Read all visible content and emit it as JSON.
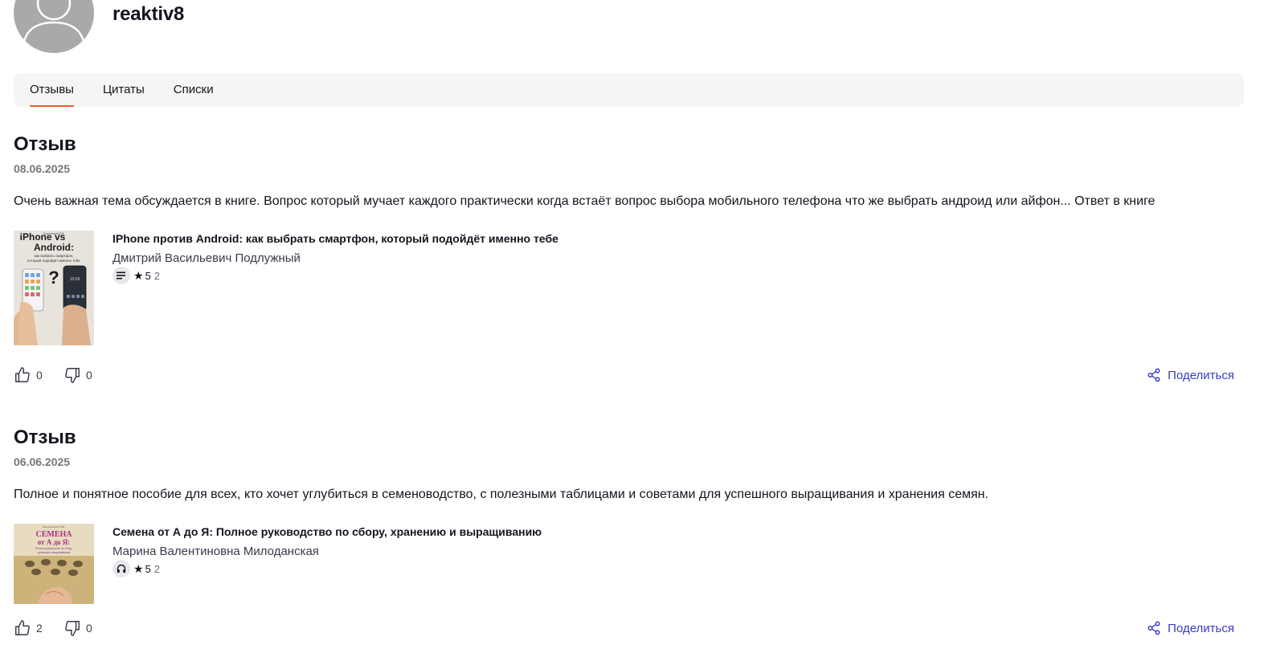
{
  "profile": {
    "username": "reaktiv8"
  },
  "tabs": [
    {
      "label": "Отзывы",
      "active": true
    },
    {
      "label": "Цитаты",
      "active": false
    },
    {
      "label": "Списки",
      "active": false
    }
  ],
  "reviews": [
    {
      "title": "Отзыв",
      "date": "08.06.2025",
      "text": "Очень важная тема обсуждается в книге. Вопрос который мучает каждого практически когда встаёт вопрос выбора мобильного телефона что же выбрать андроид или айфон... Ответ в книге",
      "book": {
        "title": "IPhone против Android: как выбрать смартфон, который подойдёт именно тебе",
        "author": "Дмитрий Васильевич Подлужный",
        "type_icon": "text-lines-icon",
        "rating": "5",
        "rating_count": "2",
        "cover": {
          "top_label": "Подлужный Д.В.",
          "line1": "iPhone vs",
          "line2": "Android:",
          "subtitle1": "как выбрать смартфон,",
          "subtitle2": "который подойдёт именно тебе",
          "screen_time": "10:09"
        }
      },
      "likes": "0",
      "dislikes": "0",
      "share_label": "Поделиться"
    },
    {
      "title": "Отзыв",
      "date": "06.06.2025",
      "text": "Полное и понятное пособие для всех, кто хочет углубиться в семеноводство, с полезными таблицами и советами для успешного выращивания и хранения семян.",
      "book": {
        "title": "Семена от А до Я: Полное руководство по сбору, хранению и выращиванию",
        "author": "Марина Валентиновна Милоданская",
        "type_icon": "headphones-icon",
        "rating": "5",
        "rating_count": "2",
        "cover": {
          "top_label": "Милоданская М.В.",
          "line1": "СЕМЕНА",
          "line2": "от А до Я:",
          "subtitle1": "Полное руководство по сбору,",
          "subtitle2": "хранению и выращиванию"
        }
      },
      "likes": "2",
      "dislikes": "0",
      "share_label": "Поделиться"
    }
  ],
  "colors": {
    "accent": "#f0582a",
    "link": "#3a3ac6",
    "tab_bar_bg": "#f5f5f4",
    "avatar_bg": "#a9a9a9"
  }
}
